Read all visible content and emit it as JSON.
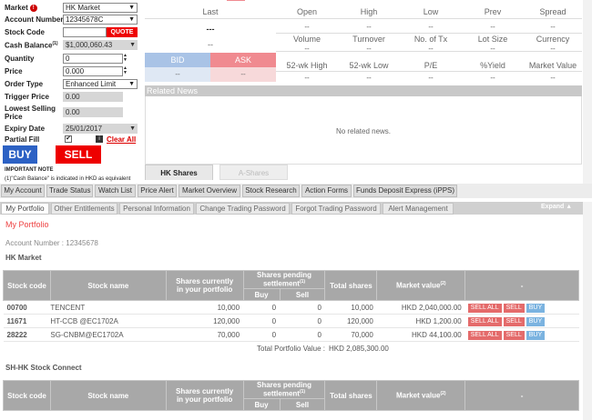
{
  "order_form": {
    "market_label": "Market",
    "market_value": "HK Market",
    "account_label": "Account Number",
    "account_value": "12345678C",
    "stock_code_label": "Stock Code",
    "stock_code_value": "",
    "quote_label": "QUOTE",
    "cash_balance_label": "Cash Balance",
    "cash_balance_sup": "(1)",
    "cash_balance_value": "$1,000,060.43",
    "quantity_label": "Quantity",
    "quantity_value": "0",
    "price_label": "Price",
    "price_value": "0.000",
    "order_type_label": "Order Type",
    "order_type_value": "Enhanced Limit",
    "trigger_price_label": "Trigger Price",
    "trigger_price_value": "0.00",
    "lowest_selling_label_1": "Lowest Selling",
    "lowest_selling_label_2": "Price",
    "lowest_selling_value": "0.00",
    "expiry_label": "Expiry Date",
    "expiry_value": "25/01/2017",
    "partial_fill_label": "Partial Fill",
    "info_icon": "i",
    "clear_all_label": "Clear All",
    "buy_label": "BUY",
    "sell_label": "SELL",
    "important_note": "IMPORTANT NOTE",
    "cash_note": "(1)\"Cash Balance\" is indicated in HKD as equivalent"
  },
  "quote": {
    "last_label": "Last",
    "last_value": "---",
    "change_value": "--",
    "open_label": "Open",
    "high_label": "High",
    "low_label": "Low",
    "prev_label": "Prev",
    "spread_label": "Spread",
    "volume_label": "Volume",
    "turnover_label": "Turnover",
    "no_tx_label": "No. of Tx",
    "lot_size_label": "Lot Size",
    "currency_label": "Currency",
    "wk_high_label": "52-wk High",
    "wk_low_label": "52-wk Low",
    "pe_label": "P/E",
    "yield_label": "%Yield",
    "market_value_label": "Market Value",
    "dash": "--",
    "bid_label": "BID",
    "ask_label": "ASK",
    "bid_value": "--",
    "ask_value": "--",
    "related_news_label": "Related News",
    "no_news": "No related news."
  },
  "market_tabs": [
    "HK Shares",
    "A-Shares"
  ],
  "nav_buttons": [
    "My Account",
    "Trade Status",
    "Watch List",
    "Price Alert",
    "Market Overview",
    "Stock Research",
    "Action Forms",
    "Funds Deposit Express (iPPS)"
  ],
  "sub_tabs": [
    "My Portfolio",
    "Other Entitlements",
    "Personal Information",
    "Change Trading Password",
    "Forgot Trading Password",
    "Alert Management"
  ],
  "expand_label": "Expand",
  "portfolio": {
    "title": "My Portfolio",
    "account_line": "Account Number : 12345678",
    "hk_title": "HK Market",
    "sh_title": "SH-HK Stock Connect",
    "headers": {
      "stock_code": "Stock code",
      "stock_name": "Stock name",
      "shares_current_1": "Shares currently",
      "shares_current_2": "in your portfolio",
      "shares_pending_1": "Shares pending",
      "shares_pending_2": "settlement",
      "pending_sup": "(1)",
      "buy": "Buy",
      "sell": "Sell",
      "total_shares": "Total shares",
      "market_value": "Market value",
      "mv_sup": "(2)",
      "dash": "-"
    },
    "rows": [
      {
        "code": "00700",
        "name": "TENCENT",
        "current": "10,000",
        "buy": "0",
        "sell": "0",
        "total": "10,000",
        "value": "HKD 2,040,000.00"
      },
      {
        "code": "11671",
        "name": "HT-CCB @EC1702A",
        "current": "120,000",
        "buy": "0",
        "sell": "0",
        "total": "120,000",
        "value": "HKD 1,200.00"
      },
      {
        "code": "28222",
        "name": "SG-CNBM@EC1702A",
        "current": "70,000",
        "buy": "0",
        "sell": "0",
        "total": "70,000",
        "value": "HKD 44,100.00"
      }
    ],
    "actions": {
      "sell_all": "SELL ALL",
      "sell": "SELL",
      "buy": "BUY"
    },
    "total_label": "Total Portfolio Value :",
    "total_value": "HKD 2,085,300.00"
  },
  "colors": {
    "buy": "#2c61c4",
    "sell": "#ee0000",
    "bid": "#a9c3e6",
    "ask": "#f08a90",
    "title_red": "#e44444"
  }
}
